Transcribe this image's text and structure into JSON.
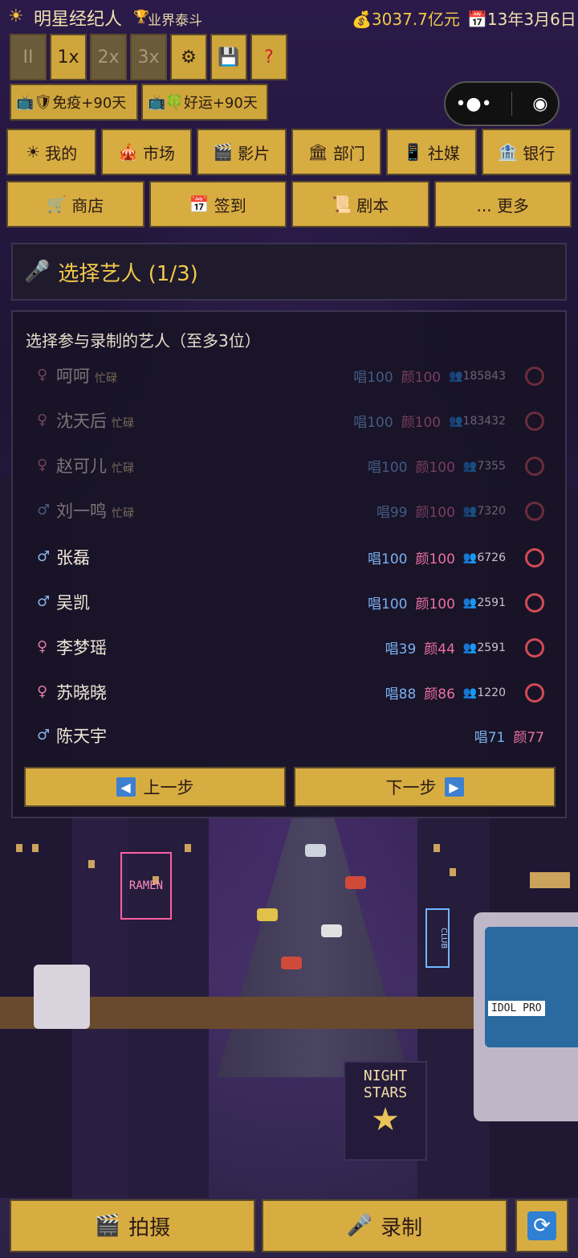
{
  "status": {
    "app_title": "明星经纪人",
    "rank": "业界泰斗",
    "money": "3037.7亿元",
    "date": "13年3月6日"
  },
  "speed_controls": {
    "pause": "II",
    "x1": "1x",
    "x2": "2x",
    "x3": "3x"
  },
  "buffs": [
    {
      "label": "免疫+90天"
    },
    {
      "label": "好运+90天"
    }
  ],
  "nav_row1": [
    {
      "icon": "sun-icon",
      "label": "我的"
    },
    {
      "icon": "circus-tent-icon",
      "label": "市场"
    },
    {
      "icon": "clapperboard-icon",
      "label": "影片"
    },
    {
      "icon": "building-icon",
      "label": "部门"
    },
    {
      "icon": "phone-icon",
      "label": "社媒"
    },
    {
      "icon": "bank-icon",
      "label": "银行"
    }
  ],
  "nav_row2": [
    {
      "icon": "cart-icon",
      "label": "商店"
    },
    {
      "icon": "calendar-icon",
      "label": "签到"
    },
    {
      "icon": "script-icon",
      "label": "剧本"
    },
    {
      "icon": "more-icon",
      "label": "... 更多"
    }
  ],
  "dialog": {
    "title": "选择艺人 (1/3)",
    "subtitle": "选择参与录制的艺人（至多3位）",
    "artists": [
      {
        "name": "呵呵",
        "gender": "♀",
        "busy": "忙碌",
        "sing": "唱100",
        "look": "颜100",
        "fans": "185843"
      },
      {
        "name": "沈天后",
        "gender": "♀",
        "busy": "忙碌",
        "sing": "唱100",
        "look": "颜100",
        "fans": "183432"
      },
      {
        "name": "赵可儿",
        "gender": "♀",
        "busy": "忙碌",
        "sing": "唱100",
        "look": "颜100",
        "fans": "7355"
      },
      {
        "name": "刘一鸣",
        "gender": "♂",
        "busy": "忙碌",
        "sing": "唱99",
        "look": "颜100",
        "fans": "7320"
      },
      {
        "name": "张磊",
        "gender": "♂",
        "busy": "",
        "sing": "唱100",
        "look": "颜100",
        "fans": "6726"
      },
      {
        "name": "吴凯",
        "gender": "♂",
        "busy": "",
        "sing": "唱100",
        "look": "颜100",
        "fans": "2591"
      },
      {
        "name": "李梦瑶",
        "gender": "♀",
        "busy": "",
        "sing": "唱39",
        "look": "颜44",
        "fans": "2591"
      },
      {
        "name": "苏晓晓",
        "gender": "♀",
        "busy": "",
        "sing": "唱88",
        "look": "颜86",
        "fans": "1220"
      },
      {
        "name": "陈天宇",
        "gender": "♂",
        "busy": "",
        "sing": "唱71",
        "look": "颜77",
        "fans": ""
      }
    ],
    "prev": "上一步",
    "next": "下一步"
  },
  "bottom": {
    "shoot": "拍摄",
    "record": "录制"
  },
  "scene": {
    "sign_ramen": "RAMEN",
    "sign_club": "CLUB",
    "poster_line1": "NIGHT",
    "poster_line2": "STARS",
    "monitor_text": "IDOL PRO"
  }
}
